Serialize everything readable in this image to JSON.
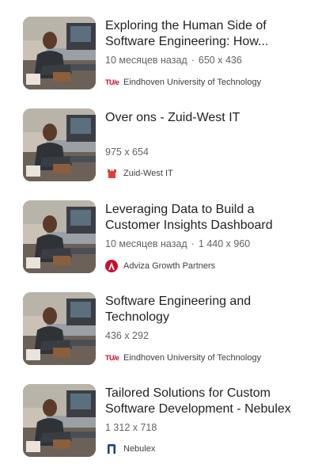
{
  "results": [
    {
      "title": "Exploring the Human Side of Software Engineering: How...",
      "meta_date": "10 месяцев назад",
      "meta_size": "650 x 436",
      "source": "Eindhoven University of Technology",
      "favicon": "tue-logo-icon",
      "favicon_text": "TU/e"
    },
    {
      "title": "Over ons - Zuid-West IT",
      "meta_date": "",
      "meta_size": "975 x 654",
      "source": "Zuid-West IT",
      "favicon": "zuid-west-logo-icon"
    },
    {
      "title": "Leveraging Data to Build a Customer Insights Dashboard",
      "meta_date": "10 месяцев назад",
      "meta_size": "1 440 x 960",
      "source": "Adviza Growth Partners",
      "favicon": "adviza-logo-icon"
    },
    {
      "title": "Software Engineering and Technology",
      "meta_date": "",
      "meta_size": "436 x 292",
      "source": "Eindhoven University of Technology",
      "favicon": "tue-logo-icon",
      "favicon_text": "TU/e"
    },
    {
      "title": "Tailored Solutions for Custom Software Development - Nebulex",
      "meta_date": "",
      "meta_size": "1 312 x 718",
      "source": "Nebulex",
      "favicon": "nebulex-logo-icon"
    }
  ],
  "colors": {
    "tue_red": "#c8102e",
    "zuidwest_red": "#e0403b",
    "adviza_red": "#c8102e",
    "nebulex_blue": "#1a3a8f",
    "meta_gray": "#5f6368"
  }
}
